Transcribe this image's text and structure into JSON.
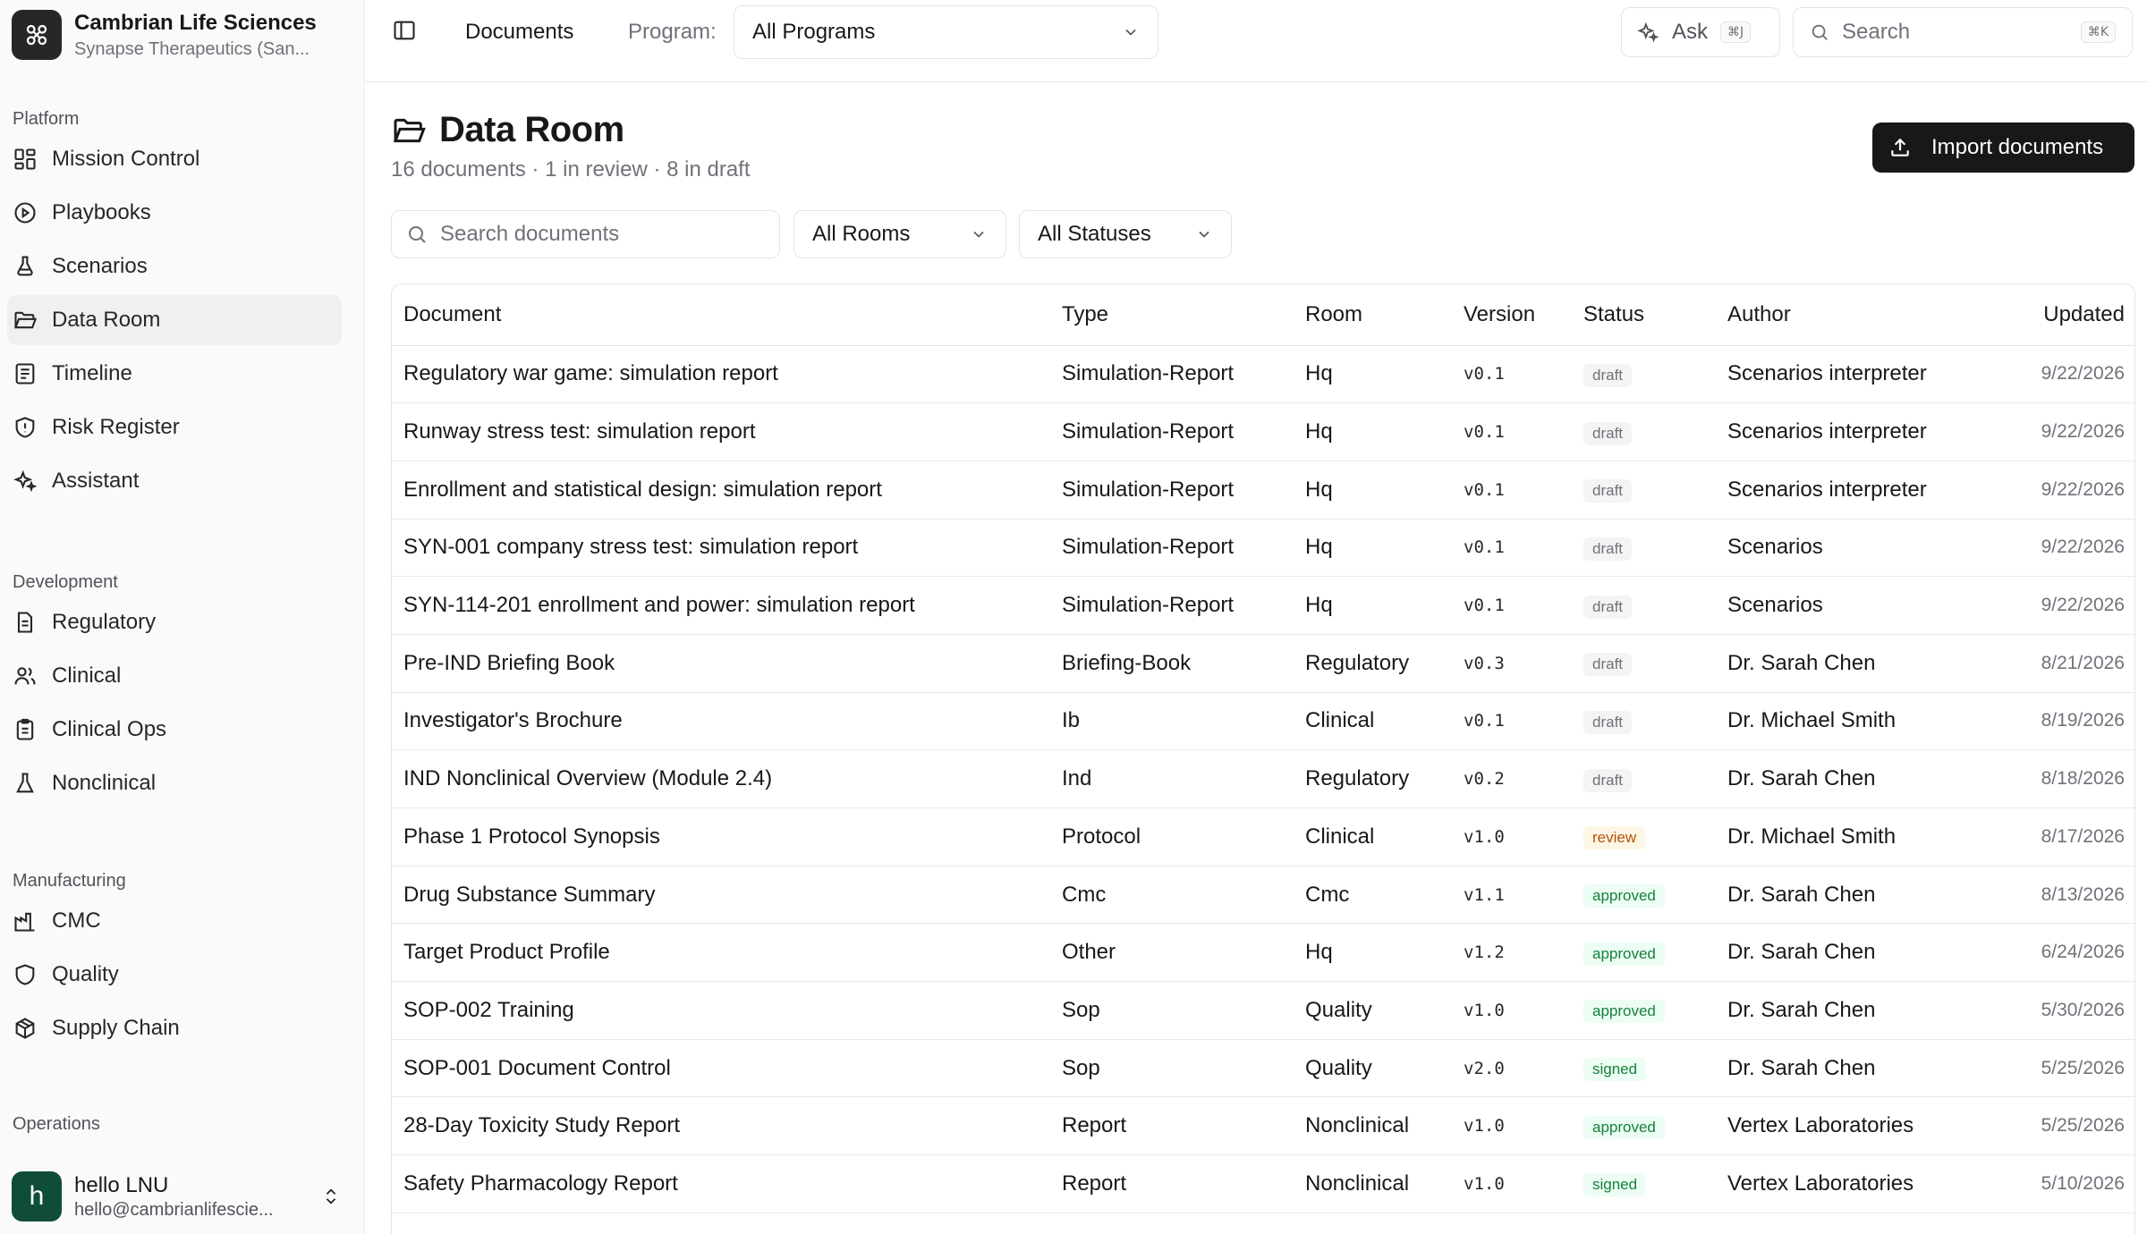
{
  "org": {
    "name": "Cambrian Life Sciences",
    "sub": "Synapse Therapeutics (San..."
  },
  "nav": {
    "platform": {
      "header": "Platform",
      "items": [
        {
          "label": "Mission Control",
          "icon": "dashboard-icon"
        },
        {
          "label": "Playbooks",
          "icon": "play-circle-icon"
        },
        {
          "label": "Scenarios",
          "icon": "flask-icon"
        },
        {
          "label": "Data Room",
          "icon": "folder-open-icon"
        },
        {
          "label": "Timeline",
          "icon": "list-icon"
        },
        {
          "label": "Risk Register",
          "icon": "shield-alert-icon"
        },
        {
          "label": "Assistant",
          "icon": "sparkles-icon"
        }
      ]
    },
    "development": {
      "header": "Development",
      "items": [
        {
          "label": "Regulatory",
          "icon": "document-icon"
        },
        {
          "label": "Clinical",
          "icon": "users-icon"
        },
        {
          "label": "Clinical Ops",
          "icon": "clipboard-icon"
        },
        {
          "label": "Nonclinical",
          "icon": "beaker-icon"
        }
      ]
    },
    "manufacturing": {
      "header": "Manufacturing",
      "items": [
        {
          "label": "CMC",
          "icon": "factory-icon"
        },
        {
          "label": "Quality",
          "icon": "shield-icon"
        },
        {
          "label": "Supply Chain",
          "icon": "package-icon"
        }
      ]
    },
    "operations": {
      "header": "Operations"
    },
    "active": "Data Room"
  },
  "user": {
    "name": "hello LNU",
    "email": "hello@cambrianlifescie...",
    "initial": "h"
  },
  "topbar": {
    "breadcrumb": "Documents",
    "program_label": "Program:",
    "program_value": "All Programs",
    "ask_label": "Ask",
    "ask_kbd": "⌘J",
    "search_placeholder": "Search",
    "search_kbd": "⌘K"
  },
  "page": {
    "title": "Data Room",
    "subtitle": "16 documents · 1 in review · 8 in draft",
    "import_label": "Import documents",
    "search_placeholder": "Search documents",
    "rooms_filter": "All Rooms",
    "status_filter": "All Statuses"
  },
  "table": {
    "columns": [
      "Document",
      "Type",
      "Room",
      "Version",
      "Status",
      "Author",
      "Updated"
    ],
    "rows": [
      {
        "doc": "Regulatory war game: simulation report",
        "type": "Simulation-Report",
        "room": "Hq",
        "version": "v0.1",
        "status": "draft",
        "author": "Scenarios interpreter",
        "updated": "9/22/2026"
      },
      {
        "doc": "Runway stress test: simulation report",
        "type": "Simulation-Report",
        "room": "Hq",
        "version": "v0.1",
        "status": "draft",
        "author": "Scenarios interpreter",
        "updated": "9/22/2026"
      },
      {
        "doc": "Enrollment and statistical design: simulation report",
        "type": "Simulation-Report",
        "room": "Hq",
        "version": "v0.1",
        "status": "draft",
        "author": "Scenarios interpreter",
        "updated": "9/22/2026"
      },
      {
        "doc": "SYN-001 company stress test: simulation report",
        "type": "Simulation-Report",
        "room": "Hq",
        "version": "v0.1",
        "status": "draft",
        "author": "Scenarios",
        "updated": "9/22/2026"
      },
      {
        "doc": "SYN-114-201 enrollment and power: simulation report",
        "type": "Simulation-Report",
        "room": "Hq",
        "version": "v0.1",
        "status": "draft",
        "author": "Scenarios",
        "updated": "9/22/2026"
      },
      {
        "doc": "Pre-IND Briefing Book",
        "type": "Briefing-Book",
        "room": "Regulatory",
        "version": "v0.3",
        "status": "draft",
        "author": "Dr. Sarah Chen",
        "updated": "8/21/2026"
      },
      {
        "doc": "Investigator's Brochure",
        "type": "Ib",
        "room": "Clinical",
        "version": "v0.1",
        "status": "draft",
        "author": "Dr. Michael Smith",
        "updated": "8/19/2026"
      },
      {
        "doc": "IND Nonclinical Overview (Module 2.4)",
        "type": "Ind",
        "room": "Regulatory",
        "version": "v0.2",
        "status": "draft",
        "author": "Dr. Sarah Chen",
        "updated": "8/18/2026"
      },
      {
        "doc": "Phase 1 Protocol Synopsis",
        "type": "Protocol",
        "room": "Clinical",
        "version": "v1.0",
        "status": "review",
        "author": "Dr. Michael Smith",
        "updated": "8/17/2026"
      },
      {
        "doc": "Drug Substance Summary",
        "type": "Cmc",
        "room": "Cmc",
        "version": "v1.1",
        "status": "approved",
        "author": "Dr. Sarah Chen",
        "updated": "8/13/2026"
      },
      {
        "doc": "Target Product Profile",
        "type": "Other",
        "room": "Hq",
        "version": "v1.2",
        "status": "approved",
        "author": "Dr. Sarah Chen",
        "updated": "6/24/2026"
      },
      {
        "doc": "SOP-002 Training",
        "type": "Sop",
        "room": "Quality",
        "version": "v1.0",
        "status": "approved",
        "author": "Dr. Sarah Chen",
        "updated": "5/30/2026"
      },
      {
        "doc": "SOP-001 Document Control",
        "type": "Sop",
        "room": "Quality",
        "version": "v2.0",
        "status": "signed",
        "author": "Dr. Sarah Chen",
        "updated": "5/25/2026"
      },
      {
        "doc": "28-Day Toxicity Study Report",
        "type": "Report",
        "room": "Nonclinical",
        "version": "v1.0",
        "status": "approved",
        "author": "Vertex Laboratories",
        "updated": "5/25/2026"
      },
      {
        "doc": "Safety Pharmacology Report",
        "type": "Report",
        "room": "Nonclinical",
        "version": "v1.0",
        "status": "signed",
        "author": "Vertex Laboratories",
        "updated": "5/10/2026"
      }
    ]
  }
}
